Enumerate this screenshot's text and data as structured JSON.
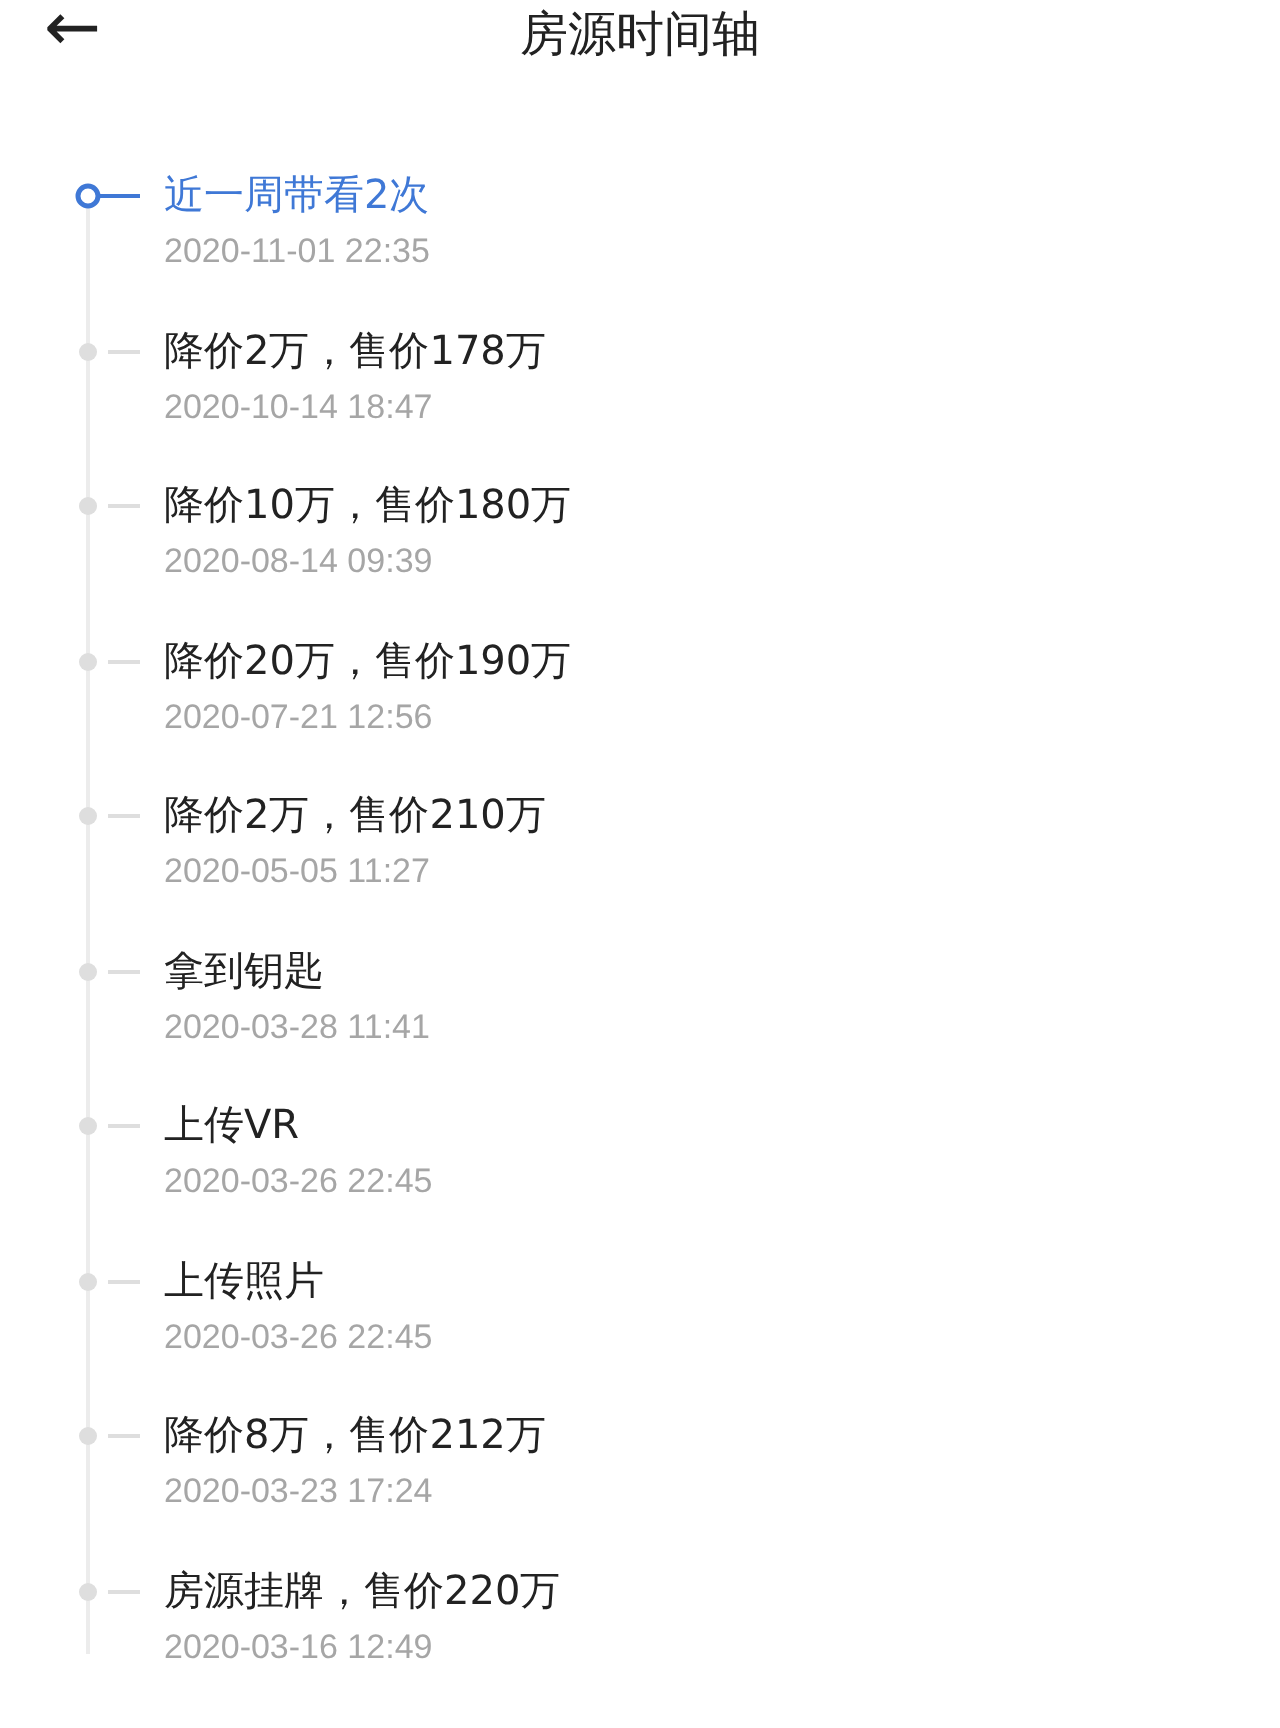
{
  "header": {
    "back": "←",
    "title": "房源时间轴"
  },
  "events": [
    {
      "title": "近一周带看2次",
      "time": "2020-11-01 22:35",
      "current": true
    },
    {
      "title": "降价2万，售价178万",
      "time": "2020-10-14 18:47",
      "current": false
    },
    {
      "title": "降价10万，售价180万",
      "time": "2020-08-14 09:39",
      "current": false
    },
    {
      "title": "降价20万，售价190万",
      "time": "2020-07-21 12:56",
      "current": false
    },
    {
      "title": "降价2万，售价210万",
      "time": "2020-05-05 11:27",
      "current": false
    },
    {
      "title": "拿到钥匙",
      "time": "2020-03-28 11:41",
      "current": false
    },
    {
      "title": "上传VR",
      "time": "2020-03-26 22:45",
      "current": false
    },
    {
      "title": "上传照片",
      "time": "2020-03-26 22:45",
      "current": false
    },
    {
      "title": "降价8万，售价212万",
      "time": "2020-03-23 17:24",
      "current": false
    },
    {
      "title": "房源挂牌，售价220万",
      "time": "2020-03-16 12:49",
      "current": false
    }
  ]
}
